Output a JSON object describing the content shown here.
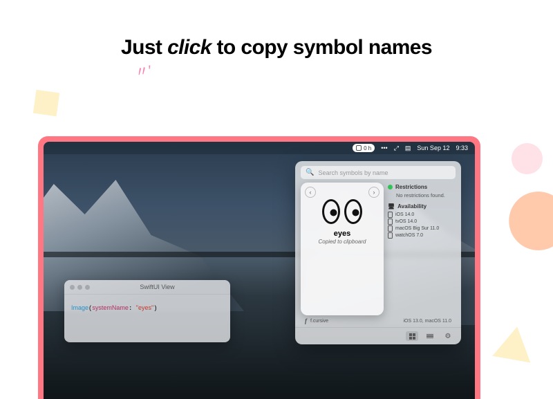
{
  "hero": {
    "pre": "Just ",
    "italic": "click",
    "post": " to copy symbol names"
  },
  "menubar": {
    "battery_pill": "0 h",
    "more": "•••",
    "date": "Sun Sep 12",
    "time": "9:33"
  },
  "code_window": {
    "title": "SwiftUI View",
    "kw": "Image",
    "arg": "systemName",
    "str": "\"eyes\""
  },
  "app": {
    "search_placeholder": "Search symbols by name",
    "popover": {
      "name": "eyes",
      "copied": "Copied to clipboard"
    },
    "info": {
      "restrictions_h": "Restrictions",
      "restrictions_body": "No restrictions found.",
      "availability_h": "Availability",
      "platforms": [
        "iOS 14.0",
        "tvOS 14.0",
        "macOS Big Sur 11.0",
        "watchOS 7.0"
      ]
    },
    "row2": {
      "name": "f.cursive",
      "meta": "iOS 13.0, macOS 11.0"
    }
  }
}
